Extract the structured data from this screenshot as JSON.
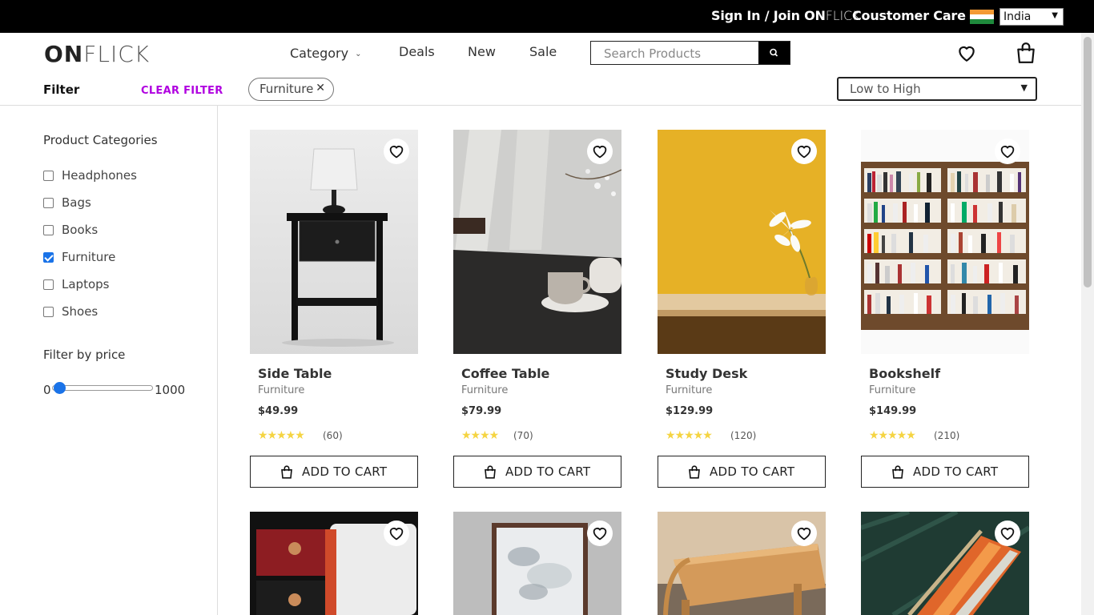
{
  "topbar": {
    "signin_prefix": "Sign In / Join ",
    "brand_bold": "ON",
    "brand_light": "FLICK",
    "customer_care": "Coustomer Care",
    "country": "India"
  },
  "header": {
    "logo_bold": "ON",
    "logo_light": "FLICK",
    "nav": [
      "Category",
      "Deals",
      "New",
      "Sale"
    ],
    "search_placeholder": "Search Products"
  },
  "filterbar": {
    "label": "Filter",
    "clear": "CLEAR FILTER",
    "chip": "Furniture",
    "sort": "Low to High"
  },
  "sidebar": {
    "categories_title": "Product Categories",
    "categories": [
      {
        "label": "Headphones",
        "checked": false
      },
      {
        "label": "Bags",
        "checked": false
      },
      {
        "label": "Books",
        "checked": false
      },
      {
        "label": "Furniture",
        "checked": true
      },
      {
        "label": "Laptops",
        "checked": false
      },
      {
        "label": "Shoes",
        "checked": false
      }
    ],
    "price_title": "Filter by price",
    "price_min": "0",
    "price_max": "1000",
    "price_slider_value": 0
  },
  "products": [
    {
      "name": "Side Table",
      "category": "Furniture",
      "price": "$49.99",
      "rating": 4.5,
      "stars": "★★★★★",
      "reviews": "(60)",
      "cta": "ADD TO CART"
    },
    {
      "name": "Coffee Table",
      "category": "Furniture",
      "price": "$79.99",
      "rating": 4,
      "stars": "★★★★",
      "reviews": "(70)",
      "cta": "ADD TO CART"
    },
    {
      "name": "Study Desk",
      "category": "Furniture",
      "price": "$129.99",
      "rating": 4.5,
      "stars": "★★★★★",
      "reviews": "(120)",
      "cta": "ADD TO CART"
    },
    {
      "name": "Bookshelf",
      "category": "Furniture",
      "price": "$149.99",
      "rating": 4.5,
      "stars": "★★★★★",
      "reviews": "(210)",
      "cta": "ADD TO CART"
    }
  ],
  "colors": {
    "accent_clear": "#b000e0",
    "checkbox": "#1a73e8",
    "star": "#f5d442"
  }
}
